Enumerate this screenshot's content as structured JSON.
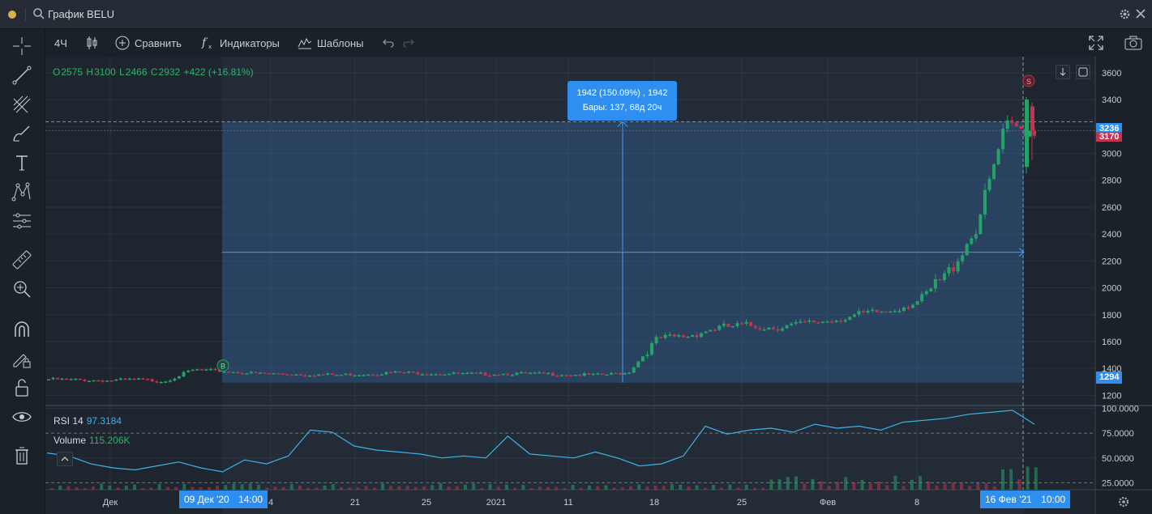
{
  "window": {
    "title": "График BELU",
    "gear_icon": "gear-icon",
    "close_icon": "close-icon"
  },
  "toolbar": {
    "interval": "4Ч",
    "compare": "Сравнить",
    "indicators": "Индикаторы",
    "templates": "Шаблоны"
  },
  "ohlc": {
    "o_label": "O",
    "o": "2575",
    "h_label": "H",
    "h": "3100",
    "l_label": "L",
    "l": "2466",
    "c_label": "C",
    "c": "2932",
    "change": "+422 (+16.81%)"
  },
  "measure_tooltip": {
    "line1": "1942 (150.09%) , 1942",
    "line2": "Бары: 137, 68д 20ч"
  },
  "price_tags": {
    "top": "3236",
    "current": "3170",
    "bottom": "1294"
  },
  "markers": {
    "buy": "B",
    "sell": "S"
  },
  "date_tags": {
    "start_date": "09 Дек '20",
    "start_time": "14:00",
    "end_date": "16 Фев '21",
    "end_time": "10:00"
  },
  "indicators": {
    "rsi_label": "RSI 14",
    "rsi_value": "97.3184",
    "volume_label": "Volume",
    "volume_value": "115.206K"
  },
  "colors": {
    "up": "#26a269",
    "down": "#c2344f",
    "accent": "#2e8ff0",
    "rsi": "#3db3e8"
  },
  "chart_data": {
    "type": "line",
    "title": "",
    "xlabel": "",
    "ylabel": "",
    "price_axis_ticks": [
      "3600",
      "3400",
      "3200",
      "3000",
      "2800",
      "2600",
      "2400",
      "2200",
      "2000",
      "1800",
      "1600",
      "1400",
      "1200"
    ],
    "rsi_axis_ticks": [
      "100.0000",
      "75.0000",
      "50.0000",
      "25.0000"
    ],
    "time_axis_ticks": [
      "Дек",
      "4",
      "21",
      "25",
      "2021",
      "11",
      "18",
      "25",
      "Фев",
      "8"
    ],
    "ylim": [
      1130,
      3720
    ],
    "rsi_ylim": [
      18,
      102
    ],
    "x": [
      "Дек",
      "4",
      "21",
      "25",
      "2021",
      "11",
      "18",
      "25",
      "Фев",
      "8",
      "16 Фев '21"
    ],
    "series": [
      {
        "values": [
          1320,
          1315,
          1310,
          1318,
          1305,
          1390,
          1380,
          1365,
          1360,
          1355,
          1352,
          1360,
          1370,
          1365,
          1360,
          1358,
          1362,
          1360,
          1355,
          1350,
          1370,
          1620,
          1640,
          1700,
          1720,
          1705,
          1730,
          1760,
          1800,
          1830,
          1900,
          2100,
          2450,
          3200,
          3170
        ]
      }
    ],
    "rsi_values": [
      55,
      52,
      44,
      40,
      38,
      42,
      46,
      40,
      36,
      48,
      44,
      52,
      78,
      76,
      62,
      58,
      56,
      54,
      50,
      52,
      50,
      72,
      54,
      52,
      50,
      56,
      50,
      42,
      44,
      52,
      82,
      74,
      78,
      80,
      76,
      84,
      80,
      82,
      78,
      86,
      88,
      90,
      94,
      96,
      98,
      84
    ],
    "measure": {
      "from_price": 1294,
      "to_price": 3236,
      "change": 1942,
      "percent": 150.09,
      "bars": 137,
      "duration": "68д 20ч"
    }
  }
}
